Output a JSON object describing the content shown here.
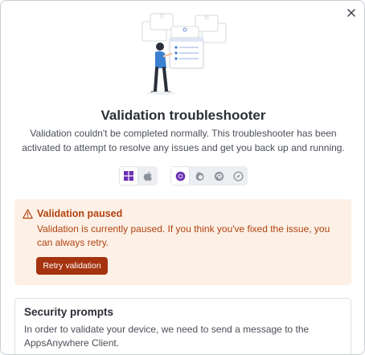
{
  "dialog": {
    "title": "Validation troubleshooter",
    "subtitle": "Validation couldn't be completed normally. This troubleshooter has been activated to attempt to resolve any issues and get you back up and running."
  },
  "icons": {
    "close": "close-icon",
    "os": [
      "windows-icon",
      "apple-icon"
    ],
    "browsers": [
      "chrome-icon",
      "firefox-icon",
      "edge-icon",
      "safari-icon"
    ],
    "alert": "warning-icon"
  },
  "selection": {
    "os": "windows",
    "browser": "chrome"
  },
  "alert": {
    "title": "Validation paused",
    "message": "Validation is currently paused. If you think you've fixed the issue, you can always retry.",
    "button_label": "Retry validation"
  },
  "security": {
    "title": "Security prompts",
    "text": "In order to validate your device, we need to send a message to the AppsAnywhere Client."
  },
  "colors": {
    "accent_purple": "#6b2fb3",
    "alert_bg": "#fdf1e7",
    "alert_text": "#b1420f",
    "retry_button": "#a5330f"
  }
}
